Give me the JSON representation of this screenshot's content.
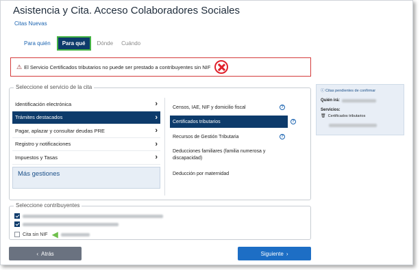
{
  "header": {
    "title": "Asistencia y Cita. Acceso Colaboradores Sociales",
    "subtitle": "Citas Nuevas"
  },
  "steps": [
    {
      "label": "Para quién",
      "state": "link"
    },
    {
      "label": "Para qué",
      "state": "active"
    },
    {
      "label": "Dónde",
      "state": "plain"
    },
    {
      "label": "Cuándo",
      "state": "plain"
    }
  ],
  "alert": {
    "message": "El Servicio Certificados tributarios no puede ser prestado a contribuyentes sin NIF",
    "icon": "warning-icon",
    "overlay_icon": "red-x-circle-icon"
  },
  "service": {
    "legend": "Seleccione el servicio de la cita",
    "categories": [
      {
        "label": "Identificación electrónica",
        "active": false
      },
      {
        "label": "Trámites destacados",
        "active": true
      },
      {
        "label": "Pagar, aplazar y consultar deudas PRE",
        "active": false
      },
      {
        "label": "Registro y notificaciones",
        "active": false
      },
      {
        "label": "Impuestos y Tasas",
        "active": false
      }
    ],
    "more_label": "Más gestiones",
    "options": [
      {
        "label": "Censos, IAE, NIF y domicilio fiscal",
        "active": false,
        "help": true
      },
      {
        "label": "Certificados tributarios",
        "active": true,
        "help": true
      },
      {
        "label": "Recursos de Gestión Tributaria",
        "active": false,
        "help": true
      },
      {
        "label": "Deducciones familiares (familia numerosa y discapacidad)",
        "active": false,
        "help": false
      },
      {
        "label": "Deducción por maternidad",
        "active": false,
        "help": false
      }
    ]
  },
  "contributors": {
    "legend": "Seleccione contribuyentes",
    "no_nif_label": "Cita sin NIF",
    "items": [
      {
        "checked": true
      },
      {
        "checked": true
      },
      {
        "checked": false
      }
    ]
  },
  "side_panel": {
    "title": "Citas pendientes de confirmar",
    "who_label": "Quién irá:",
    "services_label": "Servicios:",
    "service_item": "Certificados tributarios"
  },
  "buttons": {
    "back": "Atrás",
    "next": "Siguiente"
  },
  "colors": {
    "primary_dark": "#0d3b6b",
    "accent_blue": "#1d6ec5",
    "alert_red": "#d43a3a",
    "highlight_green": "#43b243"
  }
}
